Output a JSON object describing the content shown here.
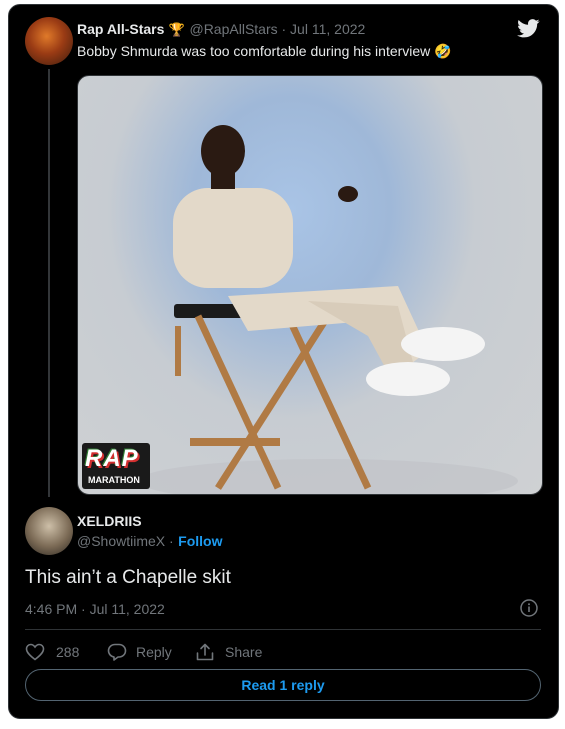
{
  "original_tweet": {
    "author_name": "Rap All-Stars",
    "trophy_icon": "🏆",
    "handle_date": "@RapAllStars · Jul 11, 2022",
    "text": "Bobby Shmurda was too comfortable during his interview",
    "emoji": "🤣",
    "media_watermark_top": "RAP",
    "media_watermark_bottom": "MARATHON"
  },
  "reply_tweet": {
    "author_name": "XELDRIIS",
    "handle": "@ShowtiimeX ·",
    "follow_label": "Follow",
    "text": "This ain’t a Chapelle skit",
    "timestamp": "4:46 PM · Jul 11, 2022",
    "like_count": "288",
    "reply_label": "Reply",
    "share_label": "Share"
  },
  "read_replies_label": "Read 1 reply",
  "colors": {
    "background": "#000000",
    "accent": "#1d9bf0",
    "text": "#e7e9ea",
    "muted": "#71767b"
  },
  "icons": [
    "twitter-bird-icon",
    "info-icon",
    "heart-icon",
    "reply-bubble-icon",
    "share-icon"
  ]
}
